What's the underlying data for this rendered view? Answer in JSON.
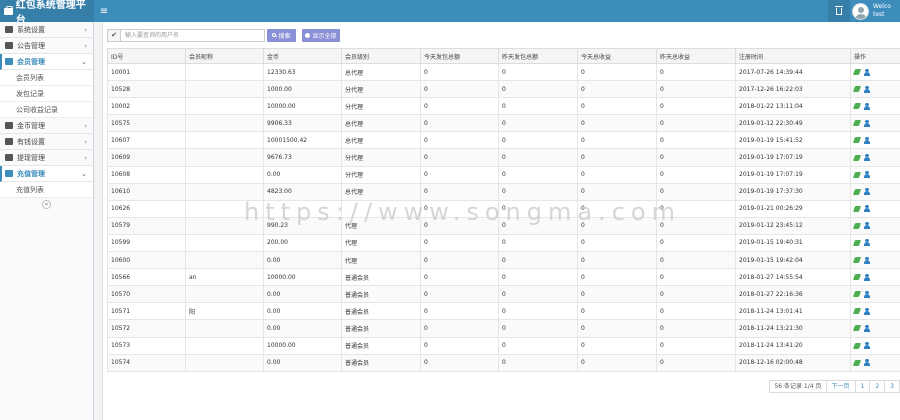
{
  "header": {
    "title": "红包系统管理平台",
    "menu_toggle": "≡",
    "user_line1": "Welco",
    "user_line2": "test"
  },
  "sidebar": {
    "items": [
      {
        "label": "系统设置"
      },
      {
        "label": "公告管理"
      },
      {
        "label": "会员管理"
      },
      {
        "label": "会员列表"
      },
      {
        "label": "发包记录"
      },
      {
        "label": "公司收益记录"
      },
      {
        "label": "金币管理"
      },
      {
        "label": "有钱设置"
      },
      {
        "label": "提现管理"
      },
      {
        "label": "充值管理"
      },
      {
        "label": "充值列表"
      }
    ],
    "collapse": "«"
  },
  "toolbar": {
    "check": "✔",
    "search_placeholder": "输入要查询的用户名",
    "search_label": "搜索",
    "showall_label": "显示全部"
  },
  "table": {
    "headers": [
      "ID号",
      "会员昵称",
      "金币",
      "会员级别",
      "今天发包总额",
      "昨天发包总额",
      "今天总收益",
      "昨天总收益",
      "注册时间",
      "操作"
    ],
    "rows": [
      [
        "10001",
        "",
        "12330.63",
        "总代理",
        "0",
        "0",
        "0",
        "0",
        "2017-07-26 14:39:44"
      ],
      [
        "10528",
        "",
        "1000.00",
        "分代理",
        "0",
        "0",
        "0",
        "0",
        "2017-12-26 16:22:03"
      ],
      [
        "10002",
        "",
        "10000.00",
        "分代理",
        "0",
        "0",
        "0",
        "0",
        "2018-01-22 13:11:04"
      ],
      [
        "10575",
        "",
        "9906.33",
        "总代理",
        "0",
        "0",
        "0",
        "0",
        "2019-01-12 22:30:49"
      ],
      [
        "10607",
        "",
        "10001500.42",
        "总代理",
        "0",
        "0",
        "0",
        "0",
        "2019-01-19 15:41:52"
      ],
      [
        "10609",
        "",
        "9676.73",
        "分代理",
        "0",
        "0",
        "0",
        "0",
        "2019-01-19 17:07:19"
      ],
      [
        "10608",
        "",
        "0.00",
        "分代理",
        "0",
        "0",
        "0",
        "0",
        "2019-01-19 17:07:19"
      ],
      [
        "10610",
        "",
        "4823.00",
        "总代理",
        "0",
        "0",
        "0",
        "0",
        "2019-01-19 17:37:30"
      ],
      [
        "10626",
        "",
        "",
        "",
        "0",
        "0",
        "0",
        "0",
        "2019-01-21 00:26:29"
      ],
      [
        "10579",
        "",
        "990.23",
        "代理",
        "0",
        "0",
        "0",
        "0",
        "2019-01-12 23:45:12"
      ],
      [
        "10599",
        "",
        "200.00",
        "代理",
        "0",
        "0",
        "0",
        "0",
        "2019-01-15 19:40:31"
      ],
      [
        "10600",
        "",
        "0.00",
        "代理",
        "0",
        "0",
        "0",
        "0",
        "2019-01-15 19:42:04"
      ],
      [
        "10566",
        "an",
        "10000.00",
        "普通会员",
        "0",
        "0",
        "0",
        "0",
        "2018-01-27 14:55:54"
      ],
      [
        "10570",
        "",
        "0.00",
        "普通会员",
        "0",
        "0",
        "0",
        "0",
        "2018-01-27 22:16:36"
      ],
      [
        "10571",
        "阳",
        "0.00",
        "普通会员",
        "0",
        "0",
        "0",
        "0",
        "2018-11-24 13:01:41"
      ],
      [
        "10572",
        "",
        "0.00",
        "普通会员",
        "0",
        "0",
        "0",
        "0",
        "2018-11-24 13:21:30"
      ],
      [
        "10573",
        "",
        "10000.00",
        "普通会员",
        "0",
        "0",
        "0",
        "0",
        "2018-11-24 13:41:20"
      ],
      [
        "10574",
        "",
        "0.00",
        "普通会员",
        "0",
        "0",
        "0",
        "0",
        "2018-12-16 02:00:48"
      ]
    ]
  },
  "pager": {
    "total": "56 条记录 1/4 页",
    "next": "下一页",
    "page1": "1",
    "page2": "2",
    "page3": "3"
  },
  "watermark": "https://www.songma.com",
  "colors": {
    "header": "#3c8dbc",
    "brand": "#367fa9",
    "button": "#8a90d6",
    "edit_icon": "#4caf50",
    "user_icon": "#2f7fc1"
  }
}
